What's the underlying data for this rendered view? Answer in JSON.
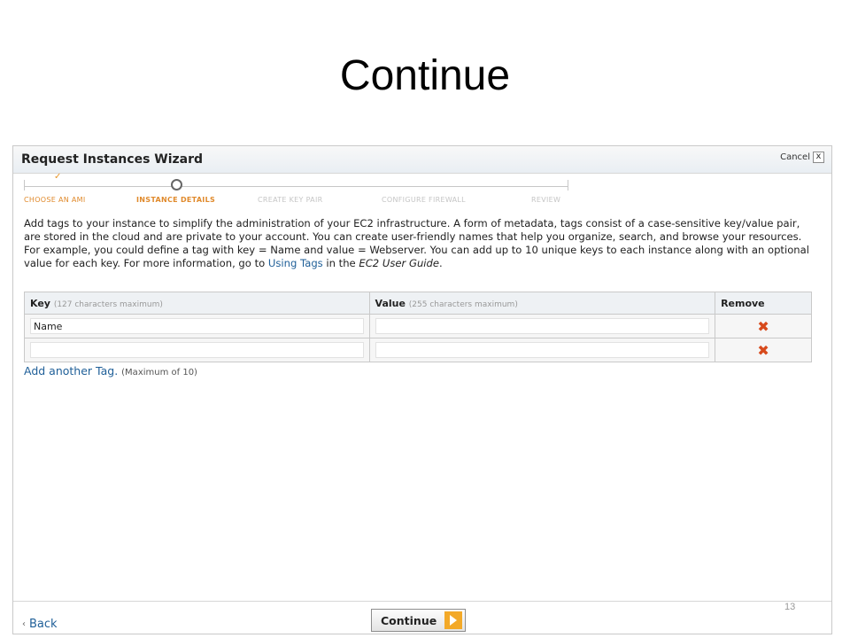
{
  "slide": {
    "title": "Continue",
    "page_number": "13"
  },
  "wizard": {
    "title": "Request Instances Wizard",
    "cancel_label": "Cancel",
    "close_glyph": "x",
    "steps": [
      {
        "label": "CHOOSE AN AMI",
        "state": "done"
      },
      {
        "label": "INSTANCE DETAILS",
        "state": "active"
      },
      {
        "label": "CREATE KEY PAIR",
        "state": "pending"
      },
      {
        "label": "CONFIGURE FIREWALL",
        "state": "pending"
      },
      {
        "label": "REVIEW",
        "state": "pending"
      }
    ],
    "check_glyph": "✓"
  },
  "description": {
    "text_main": "Add tags to your instance to simplify the administration of your EC2 infrastructure. A form of metadata, tags consist of a case-sensitive key/value pair, are stored in the cloud and are private to your account. You can create user-friendly names that help you organize, search, and browse your resources. For example, you could define a tag with key = Name and value = Webserver. You can add up to 10 unique keys to each instance along with an optional value for each key. For more information, go to ",
    "link_text": "Using Tags",
    "text_mid": " in the ",
    "guide_text": "EC2 User Guide",
    "text_end": "."
  },
  "tag_table": {
    "key_header": "Key",
    "key_hint": "(127 characters maximum)",
    "value_header": "Value",
    "value_hint": "(255 characters maximum)",
    "remove_header": "Remove",
    "remove_glyph": "✖",
    "rows": [
      {
        "key": "Name",
        "value": ""
      },
      {
        "key": "",
        "value": ""
      }
    ]
  },
  "add_tag": {
    "link": "Add another Tag.",
    "hint": "(Maximum of 10)"
  },
  "footer": {
    "back_glyph": "‹",
    "back_label": "Back",
    "continue_label": "Continue"
  },
  "colors": {
    "accent_orange": "#e08a2c",
    "link_blue": "#1f5f98",
    "remove_red": "#d74a1c"
  },
  "icons": {
    "close": "close-icon",
    "check": "check-icon",
    "remove": "remove-icon",
    "back": "chevron-left-icon",
    "continue": "arrow-right-icon"
  }
}
